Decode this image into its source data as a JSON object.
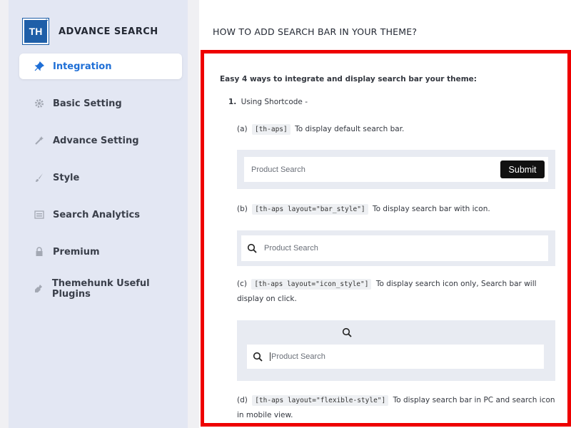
{
  "brand": {
    "logo_text": "TH",
    "title": "ADVANCE SEARCH"
  },
  "nav": [
    {
      "label": "Integration",
      "icon": "pin-icon",
      "active": true
    },
    {
      "label": "Basic Setting",
      "icon": "gear-icon"
    },
    {
      "label": "Advance Setting",
      "icon": "wand-icon"
    },
    {
      "label": "Style",
      "icon": "brush-icon"
    },
    {
      "label": "Search Analytics",
      "icon": "analytics-icon"
    },
    {
      "label": "Premium",
      "icon": "lock-icon"
    },
    {
      "label": "Themehunk Useful Plugins",
      "icon": "plugin-icon"
    }
  ],
  "main": {
    "title": "HOW TO ADD SEARCH BAR IN YOUR THEME?",
    "intro": "Easy 4 ways to integrate and display search bar your theme:",
    "step1_num": "1.",
    "step1_label": "Using Shortcode -",
    "a": {
      "prefix": "(a)",
      "code": "[th-aps]",
      "text": "To display default search bar."
    },
    "demo_a": {
      "placeholder": "Product Search",
      "button": "Submit"
    },
    "b": {
      "prefix": "(b)",
      "code": "[th-aps layout=\"bar_style\"]",
      "text": "To display search bar with icon."
    },
    "demo_b": {
      "placeholder": "Product Search"
    },
    "c": {
      "prefix": "(c)",
      "code": "[th-aps layout=\"icon_style\"]",
      "text": "To display search icon only, Search bar will display on click."
    },
    "demo_c": {
      "placeholder": "Product Search"
    },
    "d": {
      "prefix": "(d)",
      "code": "[th-aps layout=\"flexible-style\"]",
      "text": "To display search bar in PC and search icon in mobile view."
    }
  },
  "colors": {
    "accent": "#1f6fd6",
    "frame": "#ee0000",
    "sidebar": "#e3e7f3"
  }
}
